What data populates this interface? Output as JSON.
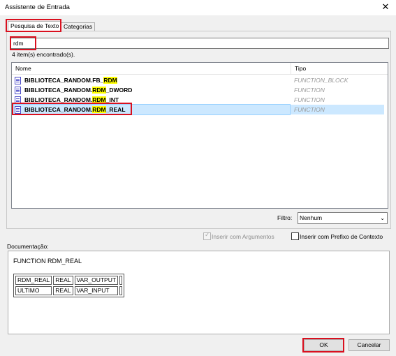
{
  "window": {
    "title": "Assistente de Entrada",
    "close_glyph": "✕"
  },
  "tabs": [
    {
      "label": "Pesquisa de Texto",
      "active": true
    },
    {
      "label": "Categorias",
      "active": false
    }
  ],
  "search": {
    "value": "rdm"
  },
  "result_count": "4 item(s) encontrado(s).",
  "columns": {
    "name": "Nome",
    "type": "Tipo"
  },
  "rows": [
    {
      "name_prefix": "BIBLIOTECA_RANDOM.FB_",
      "name_match": "RDM",
      "name_suffix": "",
      "type": "FUNCTION_BLOCK",
      "selected": false
    },
    {
      "name_prefix": "BIBLIOTECA_RANDOM.",
      "name_match": "RDM",
      "name_suffix": "_DWORD",
      "type": "FUNCTION",
      "selected": false
    },
    {
      "name_prefix": "BIBLIOTECA_RANDOM.",
      "name_match": "RDM",
      "name_suffix": "_INT",
      "type": "FUNCTION",
      "selected": false
    },
    {
      "name_prefix": "BIBLIOTECA_RANDOM.",
      "name_match": "RDM",
      "name_suffix": "_REAL",
      "type": "FUNCTION",
      "selected": true
    }
  ],
  "filter": {
    "label": "Filtro:",
    "value": "Nenhum"
  },
  "options": {
    "insert_with_args": {
      "label": "Inserir com Argumentos",
      "checked": true,
      "enabled": false
    },
    "insert_with_context": {
      "label": "Inserir com Prefixo de Contexto",
      "checked": false,
      "enabled": true
    }
  },
  "documentation": {
    "label": "Documentação:",
    "title": "FUNCTION RDM_REAL",
    "params": [
      {
        "name": "RDM_REAL",
        "type": "REAL",
        "kind": "VAR_OUTPUT"
      },
      {
        "name": "ULTIMO",
        "type": "REAL",
        "kind": "VAR_INPUT"
      }
    ]
  },
  "buttons": {
    "ok": "OK",
    "cancel": "Cancelar"
  },
  "colors": {
    "highlight": "#ffff00",
    "selection": "#cce8ff",
    "annotation": "#d9101f",
    "type_text": "#9a9a9a"
  }
}
